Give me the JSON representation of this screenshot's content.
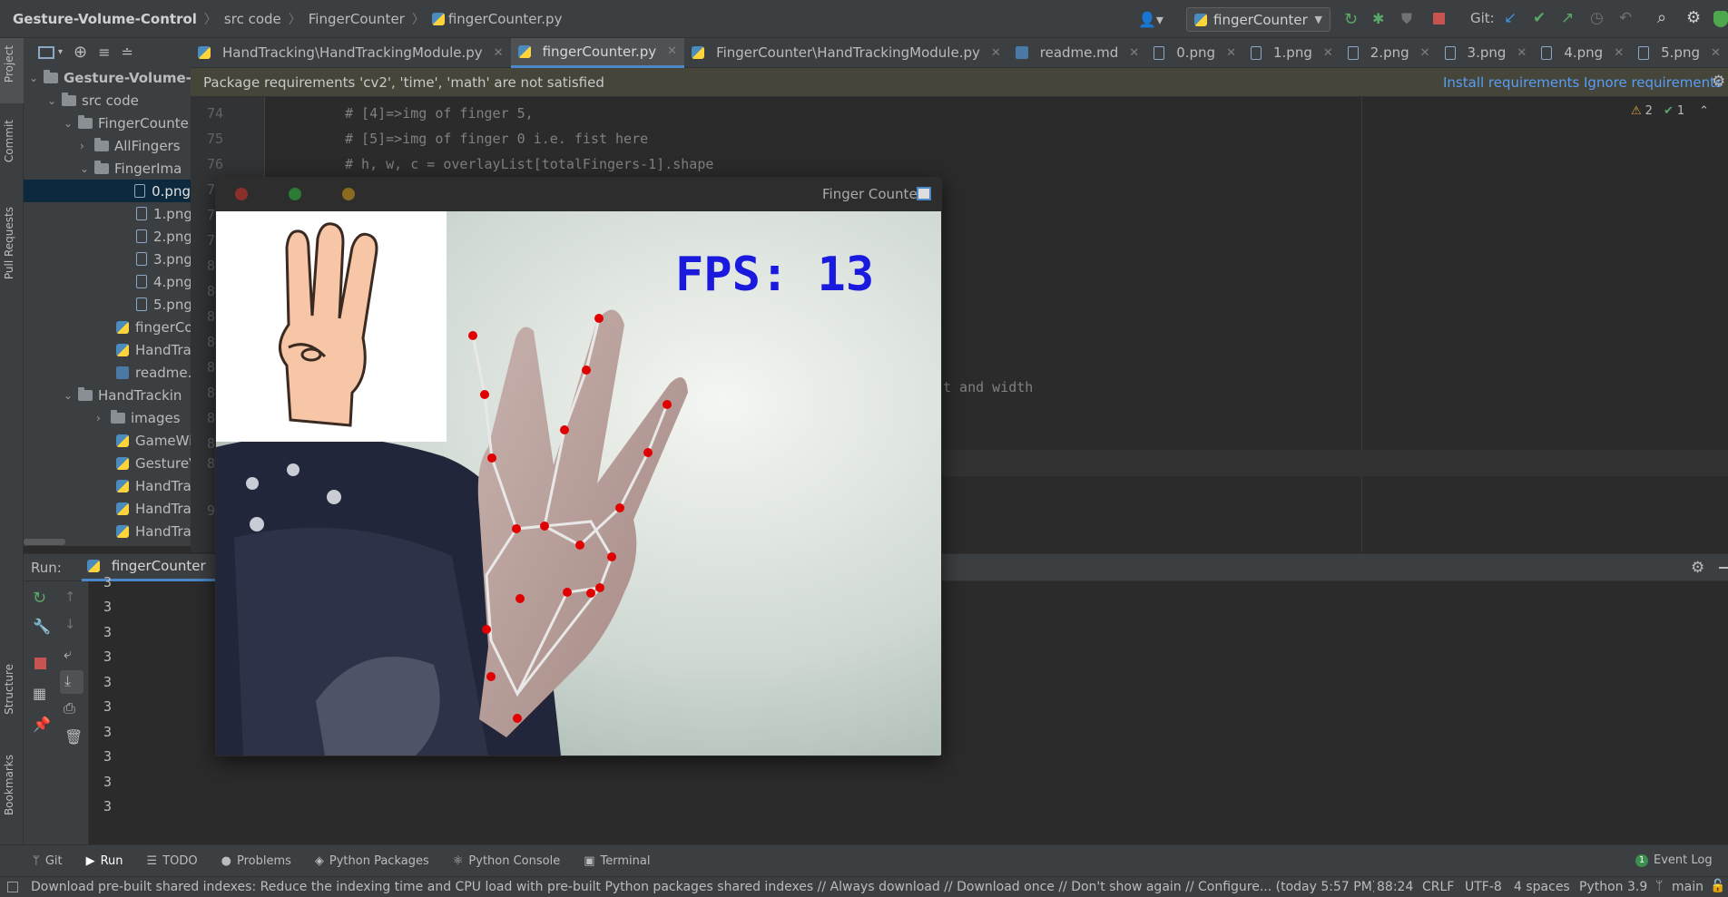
{
  "nav": {
    "project": "Gesture-Volume-Control",
    "crumbs": [
      "src code",
      "FingerCounter",
      "fingerCounter.py"
    ],
    "run_config": "fingerCounter",
    "git_label": "Git:"
  },
  "left_strip": [
    "Project",
    "Commit",
    "Pull Requests",
    "Structure",
    "Bookmarks"
  ],
  "tree": {
    "root": "Gesture-Volume-C",
    "items": [
      "src code",
      "FingerCounte",
      "AllFingers",
      "FingerIma",
      "0.png",
      "1.png",
      "2.png",
      "3.png",
      "4.png",
      "5.png",
      "fingerCou",
      "HandTrac",
      "readme.m",
      "HandTrackin",
      "images",
      "GameWit",
      "GestureVo",
      "HandTrac",
      "HandTrac",
      "HandTrac"
    ]
  },
  "tabs": [
    "HandTracking\\HandTrackingModule.py",
    "fingerCounter.py",
    "FingerCounter\\HandTrackingModule.py",
    "readme.md",
    "0.png",
    "1.png",
    "2.png",
    "3.png",
    "4.png",
    "5.png"
  ],
  "warning": {
    "message": "Package requirements 'cv2', 'time', 'math' are not satisfied",
    "install": "Install requirements",
    "ignore": "Ignore requirements"
  },
  "inspections": {
    "warnings": "2",
    "ok": "1"
  },
  "editor": {
    "line_numbers": [
      "74",
      "75",
      "76",
      "7",
      "7",
      "7",
      "8",
      "8",
      "8",
      "8",
      "8",
      "8",
      "8",
      "8",
      "8",
      "9"
    ],
    "lines": [
      "# [4]=>img of finger 5,",
      "# [5]=>img of finger 0 i.e. fist here",
      "# h, w, c = overlayList[totalFingers-1].shape"
    ],
    "trailing_fragment": "t and width"
  },
  "run": {
    "label": "Run:",
    "tab": "fingerCounter",
    "output": [
      "3",
      "3",
      "3",
      "3",
      "3",
      "3",
      "3",
      "3",
      "3",
      "3"
    ]
  },
  "bottom_tabs": [
    "Git",
    "Run",
    "TODO",
    "Problems",
    "Python Packages",
    "Python Console",
    "Terminal"
  ],
  "event_log": "Event Log",
  "event_count": "1",
  "status": {
    "message": "Download pre-built shared indexes: Reduce the indexing time and CPU load with pre-built Python packages shared indexes // Always download // Download once // Don't show again // Configure... (today 5:57 PM)",
    "position": "88:24",
    "line_sep": "CRLF",
    "encoding": "UTF-8",
    "indent": "4 spaces",
    "interpreter": "Python 3.9",
    "branch": "main"
  },
  "cv_window": {
    "title": "Finger Counter",
    "fps_text": "FPS: 13"
  },
  "colors": {
    "accent": "#4a88c7",
    "fps": "#1a1adf",
    "landmark": "#e00000",
    "link": "#589df6"
  }
}
